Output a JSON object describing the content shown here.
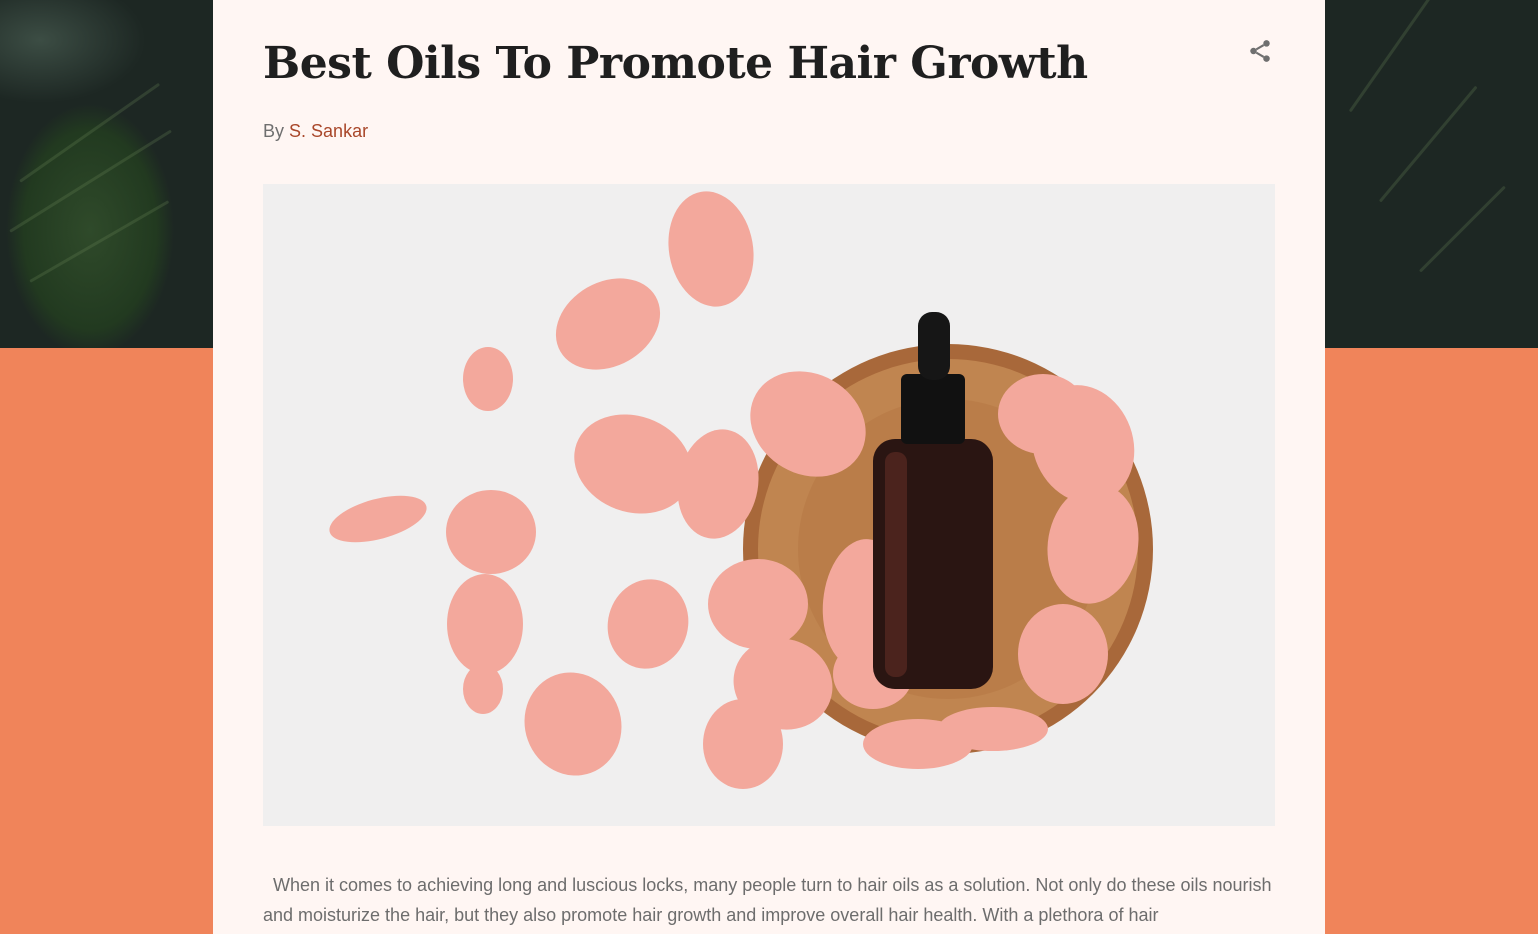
{
  "article": {
    "title": "Best Oils To Promote Hair Growth",
    "byline_prefix": "By",
    "author": "S. Sankar",
    "body": "  When it comes to achieving long and luscious locks, many people turn to hair oils as a solution. Not only do these oils nourish and moisturize the hair, but they also promote hair growth and improve overall hair health. With a plethora of hair"
  },
  "icons": {
    "share": "share-icon"
  },
  "colors": {
    "accent": "#a9472a",
    "page_background": "#f0845a",
    "card_background": "#fff6f3",
    "title": "#1f1f1f",
    "body_text": "#6d6d6d"
  }
}
